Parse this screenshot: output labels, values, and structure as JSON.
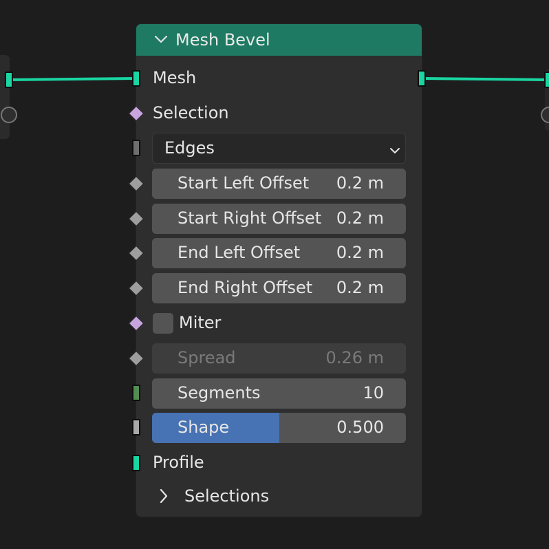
{
  "node": {
    "title": "Mesh Bevel",
    "header_color": "#1e7a62"
  },
  "sockets": {
    "mesh_input_label": "Mesh",
    "mesh_output_color": "#19d6a3",
    "selection_label": "Selection",
    "profile_label": "Profile"
  },
  "mode_dropdown": {
    "selected": "Edges"
  },
  "fields": {
    "start_left_offset": {
      "label": "Start Left Offset",
      "value": "0.2 m"
    },
    "start_right_offset": {
      "label": "Start Right Offset",
      "value": "0.2 m"
    },
    "end_left_offset": {
      "label": "End Left Offset",
      "value": "0.2 m"
    },
    "end_right_offset": {
      "label": "End Right Offset",
      "value": "0.2 m"
    },
    "spread": {
      "label": "Spread",
      "value": "0.26 m",
      "disabled": true
    },
    "segments": {
      "label": "Segments",
      "value": "10"
    },
    "shape": {
      "label": "Shape",
      "value": "0.500",
      "fill_fraction": 0.5,
      "fill_color": "#4772b3"
    }
  },
  "miter": {
    "label": "Miter",
    "checked": false
  },
  "panels": {
    "selections_label": "Selections",
    "collapsed": true
  },
  "colors": {
    "geometry_socket": "#19d6a3",
    "boolean_socket": "#c7a4de",
    "float_socket": "#9e9e9e",
    "integer_socket": "#528e52",
    "background": "#1d1d1d"
  }
}
